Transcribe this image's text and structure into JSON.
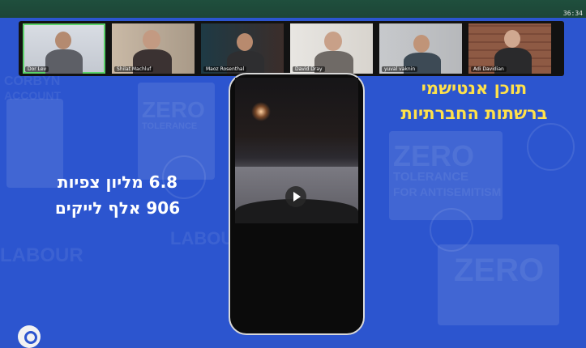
{
  "clock": "36:34",
  "participants": [
    {
      "name": "Dor Lev",
      "active": true
    },
    {
      "name": "Shilat Machluf",
      "active": false
    },
    {
      "name": "Maoz Rosenthal",
      "active": false
    },
    {
      "name": "David Dray",
      "active": false
    },
    {
      "name": "yuval vaknin",
      "active": false
    },
    {
      "name": "Adi Davidian",
      "active": false
    }
  ],
  "slide": {
    "headline_line1": "תוכן אנטישמי",
    "headline_line2": "ברשתות החברתיות",
    "stat_line1": "6.8 מליון צפיות",
    "stat_line2": "906 אלף לייקים",
    "headline_color": "#ffe14a",
    "background_color": "#2c55cf"
  },
  "background_words": [
    "ZERO",
    "TOLERANCE",
    "FOR ANTISEMITISM",
    "LABOUR",
    "CORBYN",
    "ACCOUNT",
    "ZERO",
    "ZERO"
  ],
  "icons": {
    "play": "play-icon",
    "logo": "logo-icon",
    "mic": "mic-muted-icon"
  }
}
